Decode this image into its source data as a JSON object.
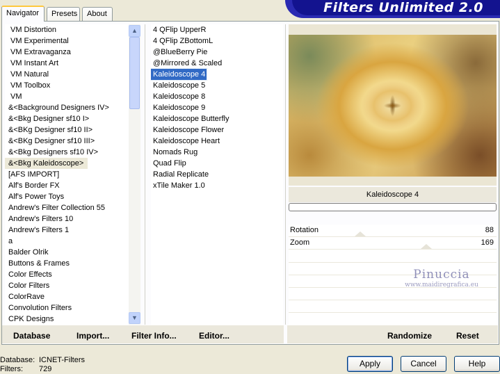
{
  "tabs": [
    "Navigator",
    "Presets",
    "About"
  ],
  "banner_title": "Filters Unlimited 2.0",
  "categories": [
    "VM Distortion",
    "VM Experimental",
    "VM Extravaganza",
    "VM Instant Art",
    "VM Natural",
    "VM Toolbox",
    "VM",
    "&<Background Designers IV>",
    "&<Bkg Designer sf10 I>",
    "&<BKg Designer sf10 II>",
    "&<BKg Designer sf10 III>",
    "&<Bkg Designers sf10 IV>",
    "&<Bkg Kaleidoscope>",
    "[AFS IMPORT]",
    "Alf's Border FX",
    "Alf's Power Toys",
    "Andrew's Filter Collection 55",
    "Andrew's Filters 10",
    "Andrew's Filters 1",
    "a",
    "Balder Olrik",
    "Buttons & Frames",
    "Color Effects",
    "Color Filters",
    "ColorRave",
    "Convolution Filters",
    "CPK Designs"
  ],
  "selected_category": "&<Bkg Kaleidoscope>",
  "filters": [
    "4 QFlip UpperR",
    "4 QFlip ZBottomL",
    "@BlueBerry Pie",
    "@Mirrored & Scaled",
    "Kaleidoscope 4",
    "Kaleidoscope 5",
    "Kaleidoscope 8",
    "Kaleidoscope 9",
    "Kaleidoscope Butterfly",
    "Kaleidoscope Flower",
    "Kaleidoscope Heart",
    "Nomads Rug",
    "Quad Flip",
    "Radial Replicate",
    "xTile Maker 1.0"
  ],
  "selected_filter": "Kaleidoscope 4",
  "preview_name": "Kaleidoscope 4",
  "sliders": [
    {
      "label": "Rotation",
      "value": "88",
      "fraction": 0.345
    },
    {
      "label": "Zoom",
      "value": "169",
      "fraction": 0.663
    }
  ],
  "watermark": {
    "name": "Pinuccia",
    "url": "www.maidiregrafica.eu"
  },
  "left_buttons": [
    "Database",
    "Import...",
    "Filter Info...",
    "Editor..."
  ],
  "right_buttons": [
    "Randomize",
    "Reset"
  ],
  "status": {
    "database_label": "Database:",
    "database_value": "ICNET-Filters",
    "filters_label": "Filters:",
    "filters_value": "729"
  },
  "dialog_buttons": {
    "apply": "Apply",
    "cancel": "Cancel",
    "help": "Help"
  }
}
